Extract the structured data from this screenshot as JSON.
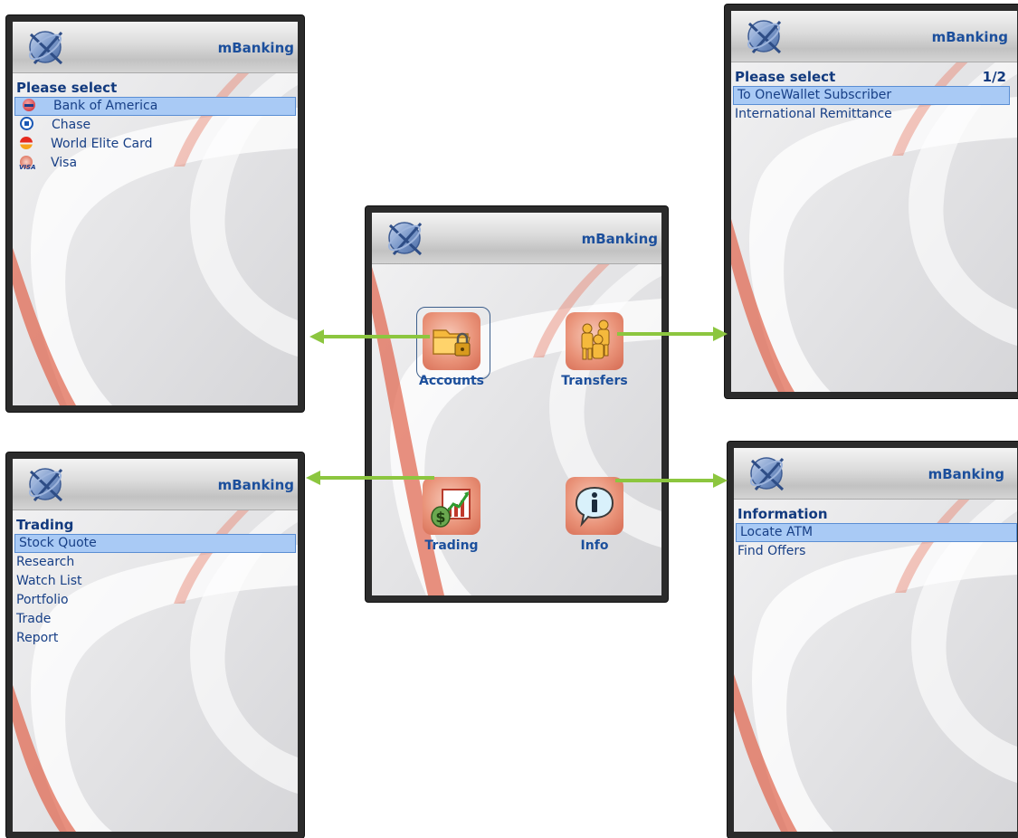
{
  "app": {
    "title": "mBanking"
  },
  "accounts_screen": {
    "heading": "Please select",
    "items": [
      {
        "label": "Bank of America",
        "icon": "bank-of-america-icon",
        "selected": true
      },
      {
        "label": "Chase",
        "icon": "chase-icon",
        "selected": false
      },
      {
        "label": "World Elite Card",
        "icon": "mastercard-icon",
        "selected": false
      },
      {
        "label": "Visa",
        "icon": "visa-icon",
        "selected": false
      }
    ]
  },
  "transfers_screen": {
    "heading": "Please select",
    "page_indicator": "1/2",
    "items": [
      {
        "label": "To OneWallet Subscriber",
        "selected": true
      },
      {
        "label": "International Remittance",
        "selected": false
      }
    ]
  },
  "trading_screen": {
    "heading": "Trading",
    "items": [
      {
        "label": "Stock Quote",
        "selected": true
      },
      {
        "label": "Research",
        "selected": false
      },
      {
        "label": "Watch List",
        "selected": false
      },
      {
        "label": "Portfolio",
        "selected": false
      },
      {
        "label": "Trade",
        "selected": false
      },
      {
        "label": "Report",
        "selected": false
      }
    ]
  },
  "info_screen": {
    "heading": "Information",
    "items": [
      {
        "label": "Locate ATM",
        "selected": true
      },
      {
        "label": "Find Offers",
        "selected": false
      }
    ]
  },
  "main_menu": {
    "tiles": [
      {
        "label": "Accounts",
        "icon": "folder-lock-icon",
        "focused": true
      },
      {
        "label": "Transfers",
        "icon": "people-transfer-icon",
        "focused": false
      },
      {
        "label": "Trading",
        "icon": "money-chart-icon",
        "focused": false
      },
      {
        "label": "Info",
        "icon": "info-bubble-icon",
        "focused": false
      }
    ]
  },
  "colors": {
    "title_blue": "#1c4f9c",
    "selection_bg": "#a9caf5",
    "arrow_green": "#8cc63f",
    "tile_red": "#e99278"
  }
}
